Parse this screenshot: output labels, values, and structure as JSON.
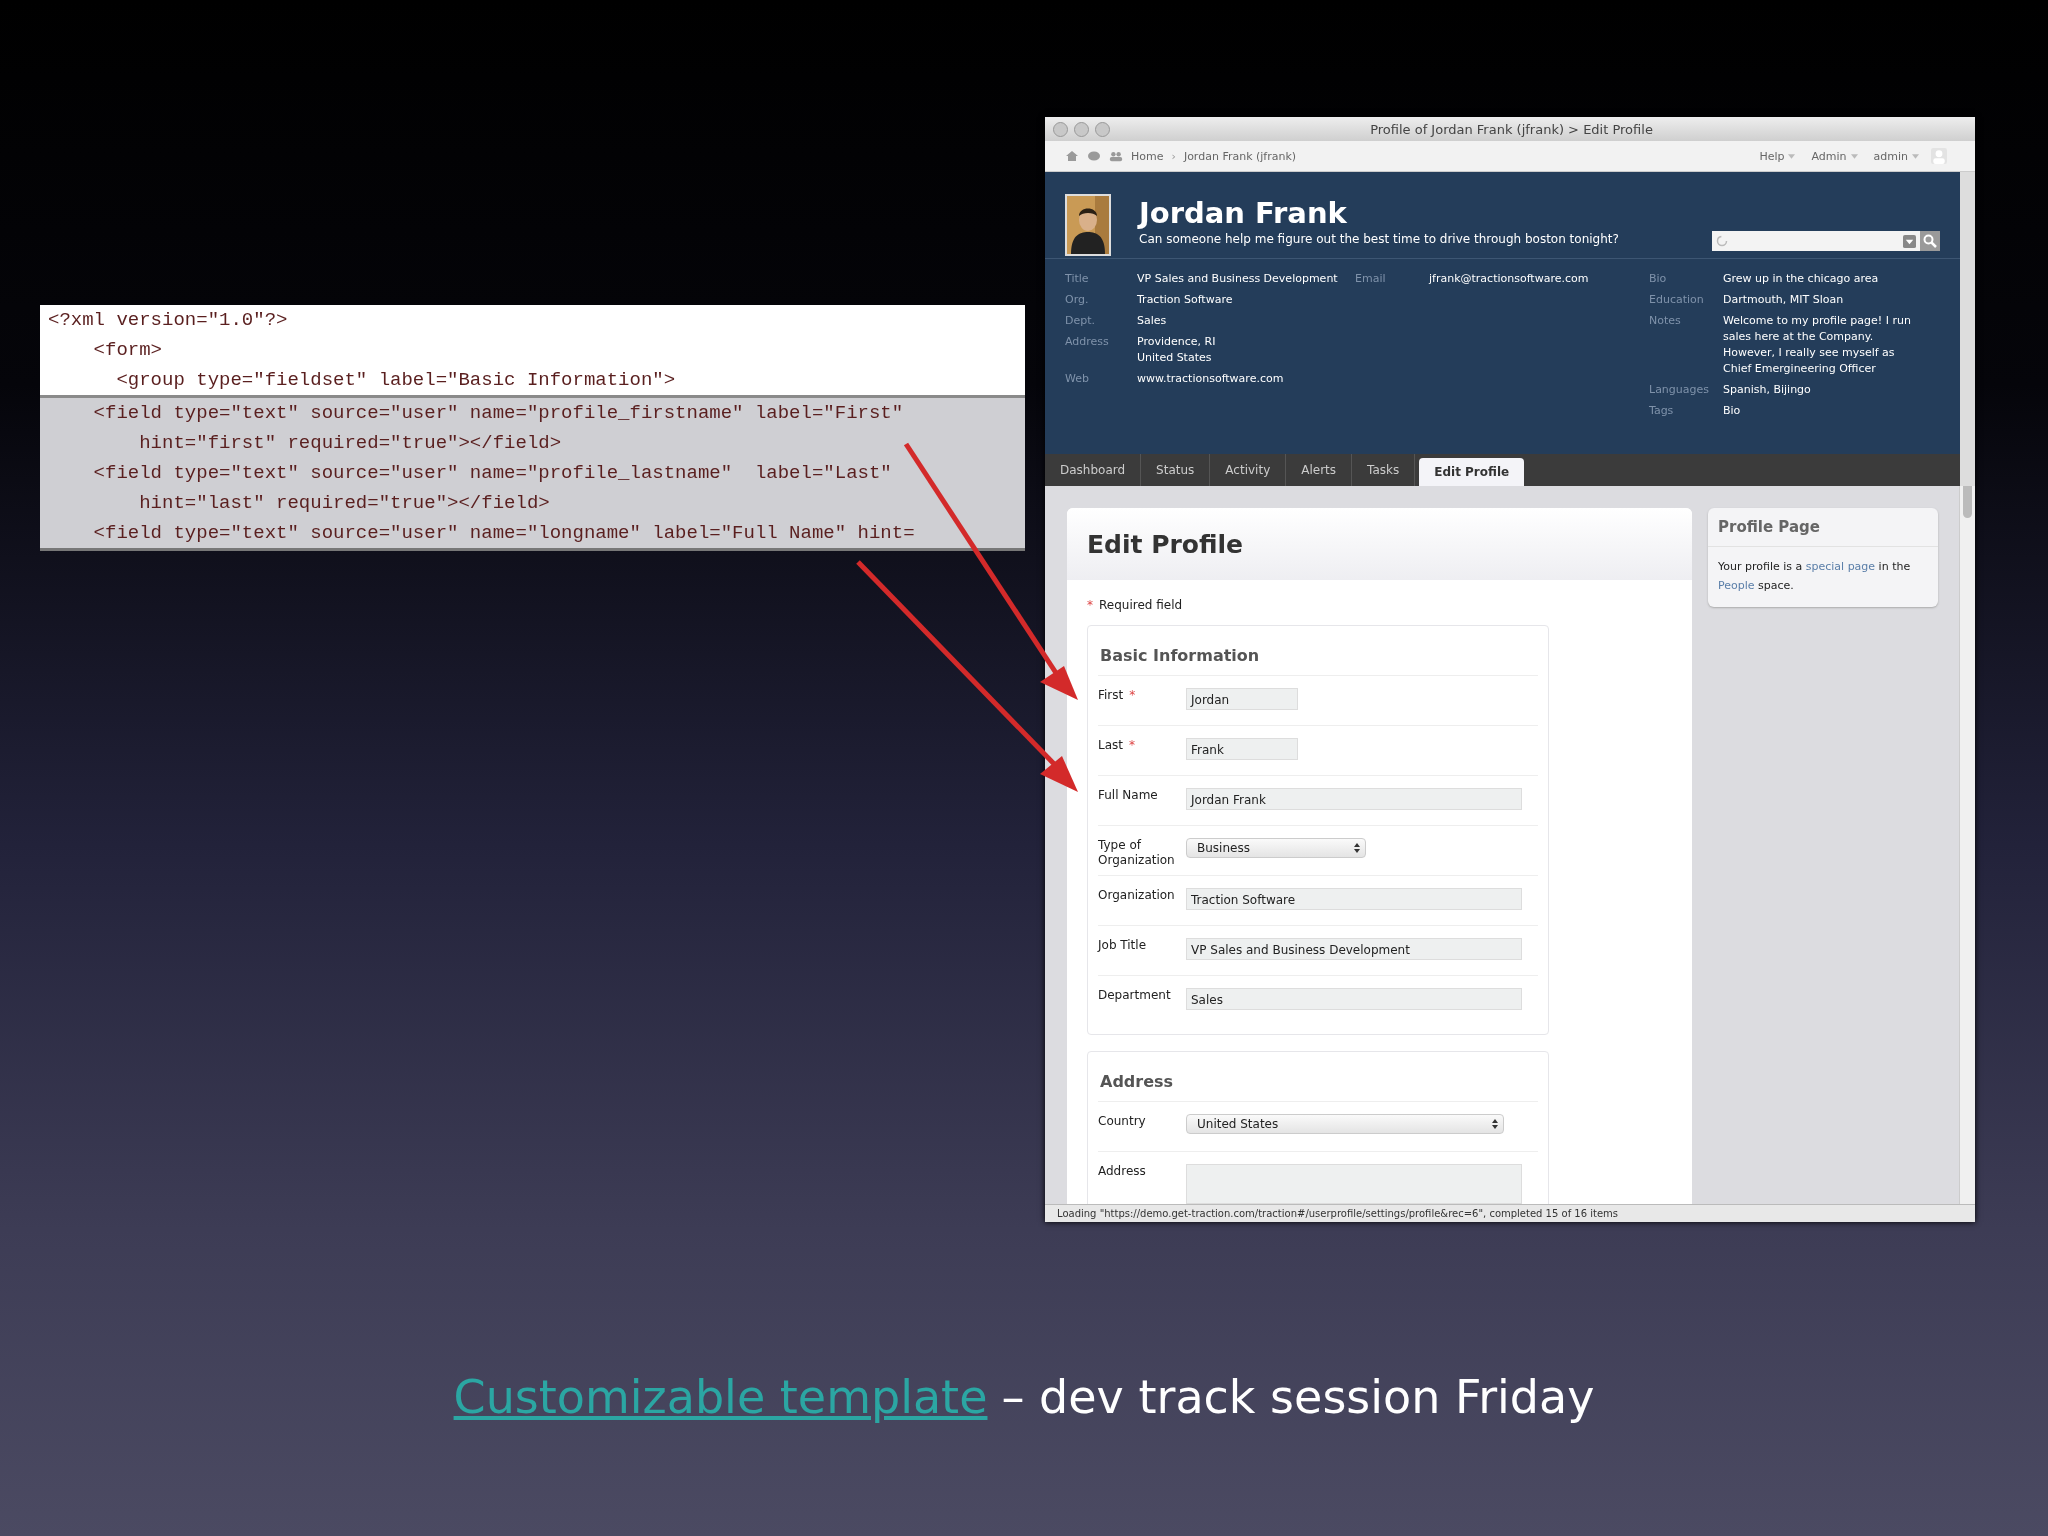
{
  "code_snippet": {
    "lines": [
      {
        "text": "<?xml version=\"1.0\"?>",
        "highlighted": false
      },
      {
        "text": "    <form>",
        "highlighted": false
      },
      {
        "text": "      <group type=\"fieldset\" label=\"Basic Information\">",
        "highlighted": false
      },
      {
        "text": "    <field type=\"text\" source=\"user\" name=\"profile_firstname\" label=\"First\"",
        "highlighted": true
      },
      {
        "text": "        hint=\"first\" required=\"true\"></field>",
        "highlighted": true
      },
      {
        "text": "    <field type=\"text\" source=\"user\" name=\"profile_lastname\"  label=\"Last\"",
        "highlighted": true
      },
      {
        "text": "        hint=\"last\" required=\"true\"></field>",
        "highlighted": true
      },
      {
        "text": "    <field type=\"text\" source=\"user\" name=\"longname\" label=\"Full Name\" hint=",
        "highlighted": true
      }
    ]
  },
  "browser": {
    "title": "Profile of Jordan Frank (jfrank) > Edit Profile",
    "breadcrumb_separator": "›",
    "breadcrumbs": [
      "Home",
      "Jordan Frank (jfrank)"
    ],
    "menus": [
      "Help",
      "Admin",
      "admin"
    ],
    "profile": {
      "name": "Jordan Frank",
      "status": "Can someone help me figure out the best time to drive through boston tonight?",
      "detail_columns": [
        [
          {
            "label": "Title",
            "value": "VP Sales and Business Development"
          },
          {
            "label": "Org.",
            "value": "Traction Software"
          },
          {
            "label": "Dept.",
            "value": "Sales"
          },
          {
            "label": "Address",
            "value": "Providence, RI\nUnited States"
          },
          {
            "label": "Web",
            "value": "www.tractionsoftware.com"
          }
        ],
        [
          {
            "label": "Email",
            "value": "jfrank@tractionsoftware.com"
          }
        ],
        [
          {
            "label": "Bio",
            "value": "Grew up in the chicago area"
          },
          {
            "label": "Education",
            "value": "Dartmouth, MIT Sloan"
          },
          {
            "label": "Notes",
            "value": "Welcome to my profile page! I run sales here at the Company. However, I really see myself as Chief Emergineering Officer"
          },
          {
            "label": "Languages",
            "value": "Spanish, Bijingo"
          },
          {
            "label": "Tags",
            "value": "Bio"
          }
        ]
      ]
    },
    "tabs": [
      {
        "label": "Dashboard",
        "selected": false
      },
      {
        "label": "Status",
        "selected": false
      },
      {
        "label": "Activity",
        "selected": false
      },
      {
        "label": "Alerts",
        "selected": false
      },
      {
        "label": "Tasks",
        "selected": false
      },
      {
        "label": "Edit Profile",
        "selected": true
      }
    ],
    "form": {
      "title": "Edit Profile",
      "required_mark": "*",
      "required_note": "Required field",
      "sections": [
        {
          "title": "Basic Information",
          "fields": [
            {
              "label": "First",
              "required": true,
              "kind": "short",
              "value": "Jordan"
            },
            {
              "label": "Last",
              "required": true,
              "kind": "short",
              "value": "Frank"
            },
            {
              "label": "Full Name",
              "required": false,
              "kind": "text",
              "value": "Jordan Frank"
            },
            {
              "label": "Type of Organization",
              "required": false,
              "kind": "select",
              "value": "Business"
            },
            {
              "label": "Organization",
              "required": false,
              "kind": "text",
              "value": "Traction Software"
            },
            {
              "label": "Job Title",
              "required": false,
              "kind": "text",
              "value": "VP Sales and Business Development"
            },
            {
              "label": "Department",
              "required": false,
              "kind": "text",
              "value": "Sales"
            }
          ]
        },
        {
          "title": "Address",
          "fields": [
            {
              "label": "Country",
              "required": false,
              "kind": "wide_select",
              "value": "United States"
            },
            {
              "label": "Address",
              "required": false,
              "kind": "textarea"
            }
          ]
        }
      ]
    },
    "sidebar": {
      "title": "Profile Page",
      "text": [
        {
          "kind": "text",
          "text": "Your profile is a "
        },
        {
          "kind": "link",
          "text": "special page"
        },
        {
          "kind": "text",
          "text": " in the "
        },
        {
          "kind": "link",
          "text": "People"
        },
        {
          "kind": "text",
          "text": " space."
        }
      ]
    },
    "status_bar": "Loading \"https://demo.get-traction.com/traction#/userprofile/settings/profile&rec=6\", completed 15 of 16 items"
  },
  "caption": {
    "link": "Customizable template",
    "text": "– dev track session Friday"
  }
}
